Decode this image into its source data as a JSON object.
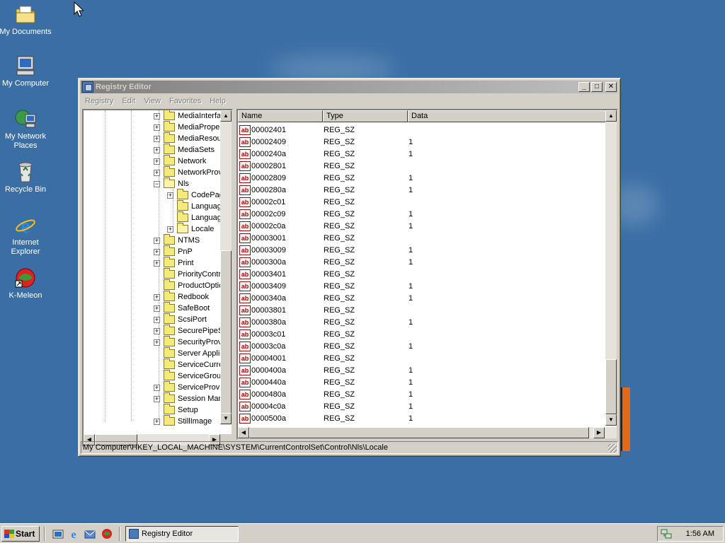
{
  "desktop": {
    "icons": [
      {
        "label": "My Documents",
        "icon": "my-documents-icon"
      },
      {
        "label": "My Computer",
        "icon": "my-computer-icon"
      },
      {
        "label": "My Network Places",
        "icon": "network-places-icon"
      },
      {
        "label": "Recycle Bin",
        "icon": "recycle-bin-icon"
      },
      {
        "label": "Internet Explorer",
        "icon": "internet-explorer-icon"
      },
      {
        "label": "K-Meleon",
        "icon": "k-meleon-icon"
      }
    ]
  },
  "window": {
    "title": "Registry Editor",
    "controls": {
      "minimize": "_",
      "maximize": "□",
      "close": "✕"
    },
    "menu": [
      "Registry",
      "Edit",
      "View",
      "Favorites",
      "Help"
    ],
    "tree": [
      {
        "label": "MediaInterfa",
        "expander": "+",
        "indent": 0
      },
      {
        "label": "MediaProperl",
        "expander": "+",
        "indent": 0
      },
      {
        "label": "MediaResour",
        "expander": "+",
        "indent": 0
      },
      {
        "label": "MediaSets",
        "expander": "+",
        "indent": 0
      },
      {
        "label": "Network",
        "expander": "+",
        "indent": 0
      },
      {
        "label": "NetworkProv",
        "expander": "+",
        "indent": 0
      },
      {
        "label": "Nls",
        "expander": "−",
        "indent": 0,
        "open": true
      },
      {
        "label": "CodePag",
        "expander": "+",
        "indent": 1
      },
      {
        "label": "Languag",
        "expander": "",
        "indent": 1
      },
      {
        "label": "Languag",
        "expander": "",
        "indent": 1
      },
      {
        "label": "Locale",
        "expander": "+",
        "indent": 1,
        "open": true
      },
      {
        "label": "NTMS",
        "expander": "+",
        "indent": 0
      },
      {
        "label": "PnP",
        "expander": "+",
        "indent": 0
      },
      {
        "label": "Print",
        "expander": "+",
        "indent": 0
      },
      {
        "label": "PriorityContr",
        "expander": "",
        "indent": 0
      },
      {
        "label": "ProductOptic",
        "expander": "",
        "indent": 0
      },
      {
        "label": "Redbook",
        "expander": "+",
        "indent": 0
      },
      {
        "label": "SafeBoot",
        "expander": "+",
        "indent": 0
      },
      {
        "label": "ScsiPort",
        "expander": "+",
        "indent": 0
      },
      {
        "label": "SecurePipeSe",
        "expander": "+",
        "indent": 0
      },
      {
        "label": "SecurityProv",
        "expander": "+",
        "indent": 0
      },
      {
        "label": "Server Applic",
        "expander": "",
        "indent": 0
      },
      {
        "label": "ServiceCurre",
        "expander": "",
        "indent": 0
      },
      {
        "label": "ServiceGroup",
        "expander": "",
        "indent": 0
      },
      {
        "label": "ServiceProvic",
        "expander": "+",
        "indent": 0
      },
      {
        "label": "Session Mana",
        "expander": "+",
        "indent": 0
      },
      {
        "label": "Setup",
        "expander": "",
        "indent": 0
      },
      {
        "label": "StillImage",
        "expander": "+",
        "indent": 0
      }
    ],
    "columns": [
      "Name",
      "Type",
      "Data"
    ],
    "values": [
      {
        "name": "00002401",
        "type": "REG_SZ",
        "data": ""
      },
      {
        "name": "00002409",
        "type": "REG_SZ",
        "data": "1"
      },
      {
        "name": "0000240a",
        "type": "REG_SZ",
        "data": "1"
      },
      {
        "name": "00002801",
        "type": "REG_SZ",
        "data": ""
      },
      {
        "name": "00002809",
        "type": "REG_SZ",
        "data": "1"
      },
      {
        "name": "0000280a",
        "type": "REG_SZ",
        "data": "1"
      },
      {
        "name": "00002c01",
        "type": "REG_SZ",
        "data": ""
      },
      {
        "name": "00002c09",
        "type": "REG_SZ",
        "data": "1"
      },
      {
        "name": "00002c0a",
        "type": "REG_SZ",
        "data": "1"
      },
      {
        "name": "00003001",
        "type": "REG_SZ",
        "data": ""
      },
      {
        "name": "00003009",
        "type": "REG_SZ",
        "data": "1"
      },
      {
        "name": "0000300a",
        "type": "REG_SZ",
        "data": "1"
      },
      {
        "name": "00003401",
        "type": "REG_SZ",
        "data": ""
      },
      {
        "name": "00003409",
        "type": "REG_SZ",
        "data": "1"
      },
      {
        "name": "0000340a",
        "type": "REG_SZ",
        "data": "1"
      },
      {
        "name": "00003801",
        "type": "REG_SZ",
        "data": ""
      },
      {
        "name": "0000380a",
        "type": "REG_SZ",
        "data": "1"
      },
      {
        "name": "00003c01",
        "type": "REG_SZ",
        "data": ""
      },
      {
        "name": "00003c0a",
        "type": "REG_SZ",
        "data": "1"
      },
      {
        "name": "00004001",
        "type": "REG_SZ",
        "data": ""
      },
      {
        "name": "0000400a",
        "type": "REG_SZ",
        "data": "1"
      },
      {
        "name": "0000440a",
        "type": "REG_SZ",
        "data": "1"
      },
      {
        "name": "0000480a",
        "type": "REG_SZ",
        "data": "1"
      },
      {
        "name": "00004c0a",
        "type": "REG_SZ",
        "data": "1"
      },
      {
        "name": "0000500a",
        "type": "REG_SZ",
        "data": "1"
      }
    ],
    "value_icon_text": "ab",
    "status": "My Computer\\HKEY_LOCAL_MACHINE\\SYSTEM\\CurrentControlSet\\Control\\Nls\\Locale"
  },
  "taskbar": {
    "start_label": "Start",
    "quick_launch": [
      "show-desktop-icon",
      "internet-explorer-icon",
      "outlook-express-icon",
      "k-meleon-icon"
    ],
    "tasks": [
      {
        "label": "Registry Editor",
        "icon": "registry-editor-icon"
      }
    ],
    "clock": "1:56 AM"
  },
  "colors": {
    "desktop": "#3a6ea5",
    "titlebar_inactive": "#808080",
    "face": "#d4d0c8"
  }
}
